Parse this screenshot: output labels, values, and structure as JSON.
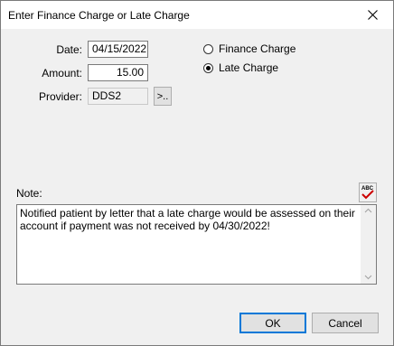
{
  "window": {
    "title": "Enter Finance Charge or Late Charge",
    "close_icon": "close-icon"
  },
  "form": {
    "date_label": "Date:",
    "date_value": "04/15/2022",
    "amount_label": "Amount:",
    "amount_value": "15.00",
    "provider_label": "Provider:",
    "provider_value": "DDS2",
    "provider_lookup_label": ">.."
  },
  "charge_type": {
    "options": [
      {
        "label": "Finance Charge",
        "selected": false
      },
      {
        "label": "Late Charge",
        "selected": true
      }
    ]
  },
  "note": {
    "label": "Note:",
    "text": "Notified patient by letter that a late charge would be assessed on their account if payment was not received by 04/30/2022!",
    "spell_check_text": "ABC"
  },
  "buttons": {
    "ok": "OK",
    "cancel": "Cancel"
  },
  "colors": {
    "accent": "#0078d7",
    "spell_check": "#cc0000"
  }
}
